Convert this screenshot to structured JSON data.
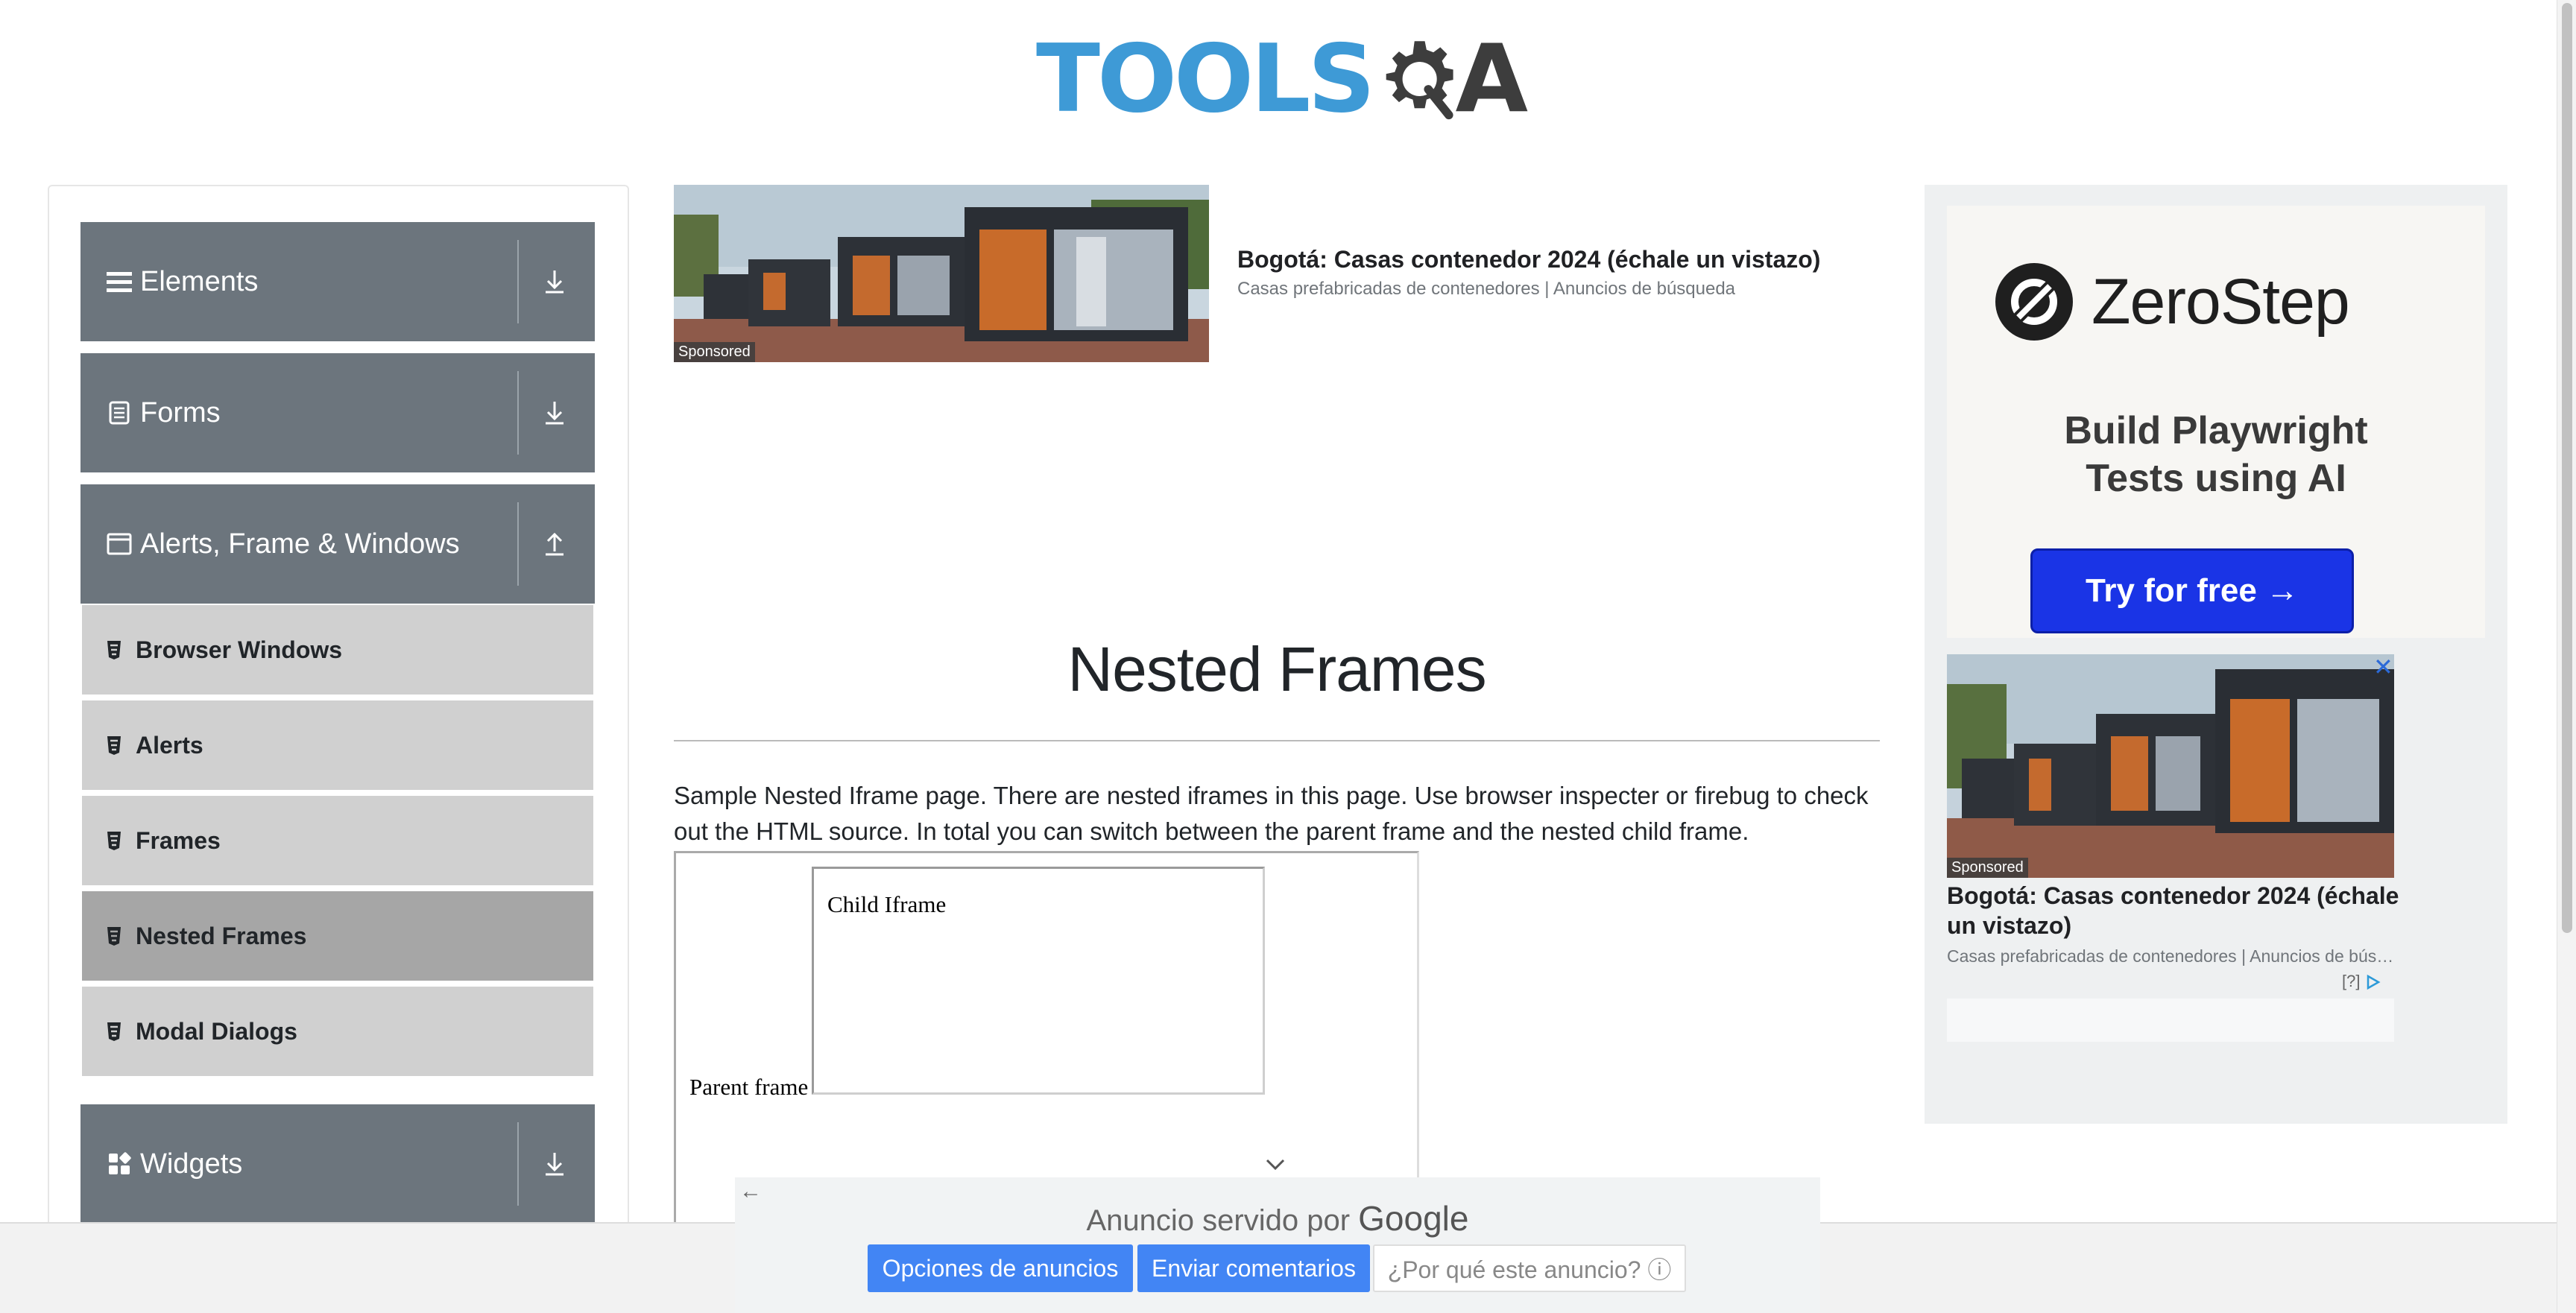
{
  "logo": {
    "tools": "TOOLS",
    "qa_q": "Q",
    "qa_a": "A"
  },
  "sidebar": {
    "groups": [
      {
        "label": "Elements",
        "icon": "hamburger-icon",
        "arrow": "download-arrow-icon"
      },
      {
        "label": "Forms",
        "icon": "document-icon",
        "arrow": "download-arrow-icon"
      },
      {
        "label": "Alerts, Frame & Windows",
        "icon": "window-icon",
        "arrow": "upload-arrow-icon"
      },
      {
        "label": "Widgets",
        "icon": "widgets-icon",
        "arrow": "download-arrow-icon"
      }
    ],
    "items": [
      {
        "label": "Browser Windows"
      },
      {
        "label": "Alerts"
      },
      {
        "label": "Frames"
      },
      {
        "label": "Nested Frames",
        "active": true
      },
      {
        "label": "Modal Dialogs"
      }
    ]
  },
  "top_ad": {
    "sponsored": "Sponsored",
    "title": "Bogotá: Casas contenedor 2024 (échale un vistazo)",
    "subtitle": "Casas prefabricadas de contenedores | Anuncios de búsqueda"
  },
  "main": {
    "title": "Nested Frames",
    "description": "Sample Nested Iframe page. There are nested iframes in this page. Use browser inspecter or firebug to check out the HTML source. In total you can switch between the parent frame and the nested child frame.",
    "parent_frame_label": "Parent frame",
    "child_frame_label": "Child Iframe"
  },
  "right_ad": {
    "brand": "ZeroStep",
    "headline_line1": "Build Playwright",
    "headline_line2": "Tests using AI",
    "cta": "Try for free →",
    "sponsored": "Sponsored",
    "close": "✕",
    "title": "Bogotá: Casas contenedor 2024 (échale un vistazo)",
    "subtitle": "Casas prefabricadas de contenedores | Anuncios de búsqueda",
    "help": "[?]"
  },
  "google_ad_bar": {
    "served_by": "Anuncio servido por",
    "google": "Google",
    "options_button": "Opciones de anuncios",
    "feedback_button": "Enviar comentarios",
    "why_button": "¿Por qué este anuncio? ⓘ"
  },
  "colors": {
    "sidebar_group": "#6c757d",
    "sidebar_item": "#d0d0d0",
    "sidebar_item_active": "#a6a6a6",
    "logo_blue": "#3e9ad6",
    "zerostep_button": "#1a34e6",
    "google_blue": "#4285f4"
  }
}
